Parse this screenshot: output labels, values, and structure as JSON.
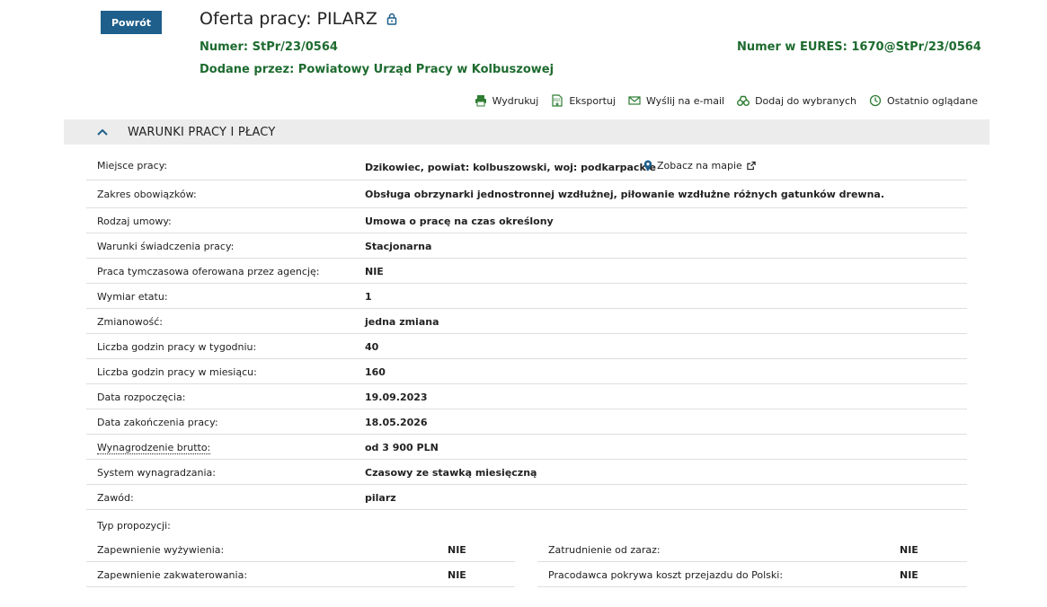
{
  "back_label": "Powrót",
  "title": "Oferta pracy: PILARZ",
  "numer": {
    "label": "Numer:",
    "value": "StPr/23/0564"
  },
  "eures": {
    "label": "Numer w EURES:",
    "value": "1670@StPr/23/0564"
  },
  "added_by": {
    "label": "Dodane przez:",
    "value": "Powiatowy Urząd Pracy w Kolbuszowej"
  },
  "toolbar": {
    "print": "Wydrukuj",
    "export": "Eksportuj",
    "email": "Wyślij na e-mail",
    "favorites": "Dodaj do wybranych",
    "recent": "Ostatnio oglądane"
  },
  "section_title": "WARUNKI PRACY I PŁACY",
  "map_link": "Zobacz na mapie",
  "rows": [
    {
      "label": "Miejsce pracy:",
      "value": "Dzikowiec, powiat: kolbuszowski, woj: podkarpackie"
    },
    {
      "label": "Zakres obowiązków:",
      "value": "Obsługa obrzynarki jednostronnej wzdłużnej, piłowanie wzdłużne różnych gatunków drewna."
    },
    {
      "label": "Rodzaj umowy:",
      "value": "Umowa o pracę na czas określony"
    },
    {
      "label": "Warunki świadczenia pracy:",
      "value": "Stacjonarna"
    },
    {
      "label": "Praca tymczasowa oferowana przez agencję:",
      "value": "NIE"
    },
    {
      "label": "Wymiar etatu:",
      "value": "1"
    },
    {
      "label": "Zmianowość:",
      "value": "jedna zmiana"
    },
    {
      "label": "Liczba godzin pracy w tygodniu:",
      "value": "40"
    },
    {
      "label": "Liczba godzin pracy w miesiącu:",
      "value": "160"
    },
    {
      "label": "Data rozpoczęcia:",
      "value": "19.09.2023"
    },
    {
      "label": "Data zakończenia pracy:",
      "value": "18.05.2026"
    },
    {
      "label": "Wynagrodzenie brutto:",
      "value": "od 3 900 PLN"
    },
    {
      "label": "System wynagradzania:",
      "value": "Czasowy ze stawką miesięczną"
    },
    {
      "label": "Zawód:",
      "value": "pilarz"
    }
  ],
  "typ_label": "Typ propozycji:",
  "typ_left": [
    {
      "label": "Zapewnienie wyżywienia:",
      "value": "NIE"
    },
    {
      "label": "Zapewnienie zakwaterowania:",
      "value": "NIE"
    }
  ],
  "typ_right": [
    {
      "label": "Zatrudnienie od zaraz:",
      "value": "NIE"
    },
    {
      "label": "Pracodawca pokrywa koszt przejazdu do Polski:",
      "value": "NIE"
    }
  ],
  "colors": {
    "primary": "#1f5f8b",
    "accent_green": "#1d6b2f",
    "section_bg": "#ececec"
  }
}
